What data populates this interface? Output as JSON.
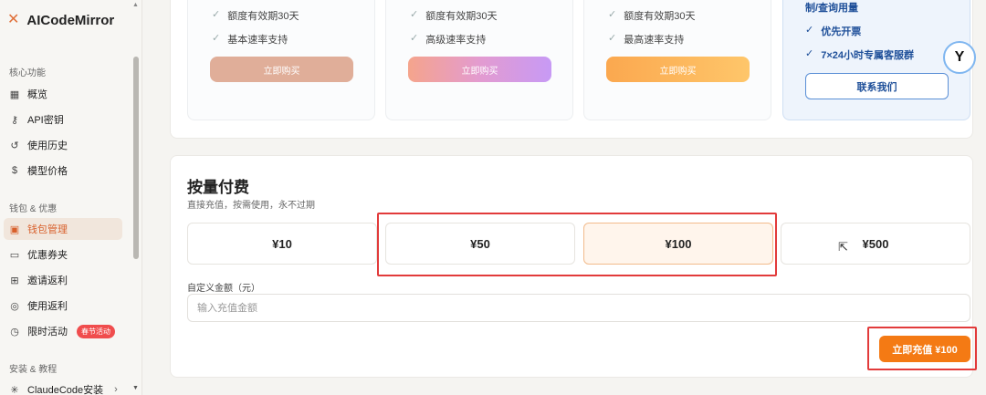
{
  "brand": {
    "icon": "close-x-icon",
    "name": "AICodeMirror"
  },
  "sidebar": {
    "sections": [
      {
        "title": "核心功能",
        "items": [
          {
            "label": "概览",
            "icon": "grid-icon"
          },
          {
            "label": "API密钥",
            "icon": "key-icon"
          },
          {
            "label": "使用历史",
            "icon": "history-icon"
          },
          {
            "label": "模型价格",
            "icon": "dollar-icon"
          }
        ]
      },
      {
        "title": "钱包 & 优惠",
        "items": [
          {
            "label": "钱包管理",
            "icon": "wallet-icon",
            "active": true
          },
          {
            "label": "优惠券夹",
            "icon": "ticket-icon"
          },
          {
            "label": "邀请返利",
            "icon": "gift-icon"
          },
          {
            "label": "使用返利",
            "icon": "coins-icon"
          },
          {
            "label": "限时活动",
            "icon": "timer-icon",
            "badge": "春节活动"
          }
        ]
      },
      {
        "title": "安装 & 教程",
        "items": [
          {
            "label": "ClaudeCode安装",
            "icon": "sun-icon"
          }
        ]
      }
    ]
  },
  "plans": [
    {
      "features": [
        "额度有效期30天",
        "基本速率支持"
      ],
      "button": "立即购买",
      "button_color": "#e2ad97"
    },
    {
      "features": [
        "额度有效期30天",
        "高级速率支持"
      ],
      "button": "立即购买",
      "button_color": "#f3a38d"
    },
    {
      "features": [
        "额度有效期30天",
        "最高速率支持"
      ],
      "button": "立即购买",
      "button_color": "#fbb357"
    }
  ],
  "enterprise": {
    "lines": [
      "制/查询用量",
      "优先开票",
      "7×24小时专属客服群"
    ],
    "button": "联系我们"
  },
  "payment": {
    "title": "按量付费",
    "subtitle": "直接充值，按需使用，永不过期",
    "amounts": [
      {
        "label": "¥10",
        "selected": false
      },
      {
        "label": "¥50",
        "selected": false
      },
      {
        "label": "¥100",
        "selected": true
      },
      {
        "label": "¥500",
        "selected": false
      }
    ],
    "custom_label": "自定义金额（元）",
    "custom_placeholder": "输入充值金额",
    "recharge_button": "立即充值 ¥100"
  },
  "colors": {
    "accent": "#f47a14",
    "highlight": "#e23b3b",
    "active_nav": "#d8602c"
  }
}
